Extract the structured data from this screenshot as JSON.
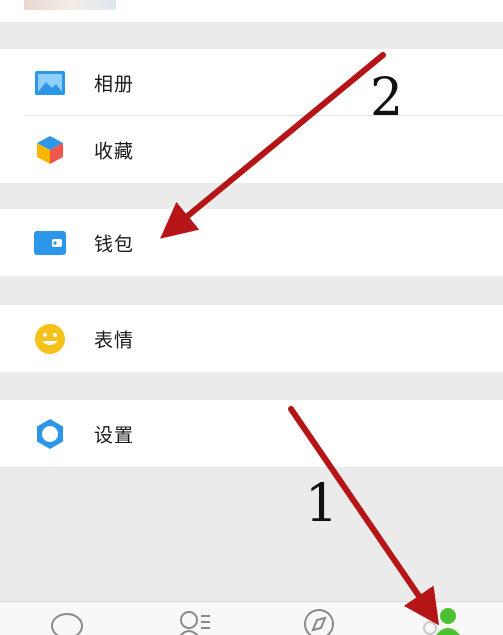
{
  "menu": {
    "album_label": "相册",
    "favorites_label": "收藏",
    "wallet_label": "钱包",
    "stickers_label": "表情",
    "settings_label": "设置"
  },
  "annotations": {
    "step_1": "1",
    "step_2": "2",
    "arrow_color": "#b51517"
  },
  "colors": {
    "album_icon": "#2c97e8",
    "wallet_icon": "#2c97e8",
    "stickers_icon": "#f6c21a",
    "settings_icon": "#2c97e8",
    "active_tab": "#4bc12f"
  },
  "tabs": [
    "chat-icon",
    "contacts-icon",
    "discover-icon",
    "me-icon"
  ]
}
